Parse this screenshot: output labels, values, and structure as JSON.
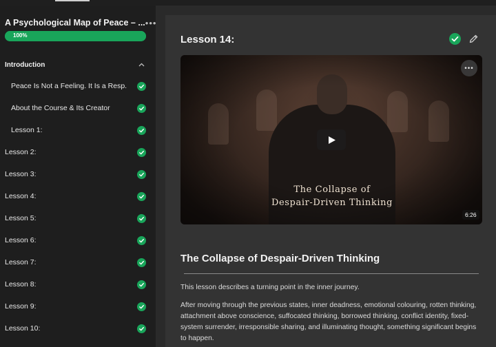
{
  "sidebar": {
    "course_title": "A Psychological Map of Peace – ...",
    "more_label": "•••",
    "progress": {
      "percent": 100,
      "label": "100%"
    },
    "section": {
      "label": "Introduction",
      "expanded": true
    },
    "items": [
      {
        "label": "Peace Is Not a Feeling. It Is a Resp...",
        "completed": true,
        "indent": true
      },
      {
        "label": "About the Course & Its Creator",
        "completed": true,
        "indent": true
      },
      {
        "label": "Lesson 1:",
        "completed": true,
        "indent": true
      },
      {
        "label": "Lesson 2:",
        "completed": true,
        "indent": false
      },
      {
        "label": "Lesson 3:",
        "completed": true,
        "indent": false
      },
      {
        "label": "Lesson 4:",
        "completed": true,
        "indent": false
      },
      {
        "label": "Lesson 5:",
        "completed": true,
        "indent": false
      },
      {
        "label": "Lesson 6:",
        "completed": true,
        "indent": false
      },
      {
        "label": "Lesson 7:",
        "completed": true,
        "indent": false
      },
      {
        "label": "Lesson 8:",
        "completed": true,
        "indent": false
      },
      {
        "label": "Lesson 9:",
        "completed": true,
        "indent": false
      },
      {
        "label": "Lesson 10:",
        "completed": true,
        "indent": false
      }
    ]
  },
  "main": {
    "lesson_heading": "Lesson 14:",
    "completed": true,
    "video": {
      "title_line1": "The Collapse of",
      "title_line2": "Despair-Driven Thinking",
      "duration": "6:26",
      "menu_label": "•••"
    },
    "content_title": "The Collapse of Despair-Driven Thinking",
    "paragraph1": "This lesson describes a turning point in the inner journey.",
    "paragraph2": "After moving through the previous states, inner deadness, emotional colouring, rotten thinking, attachment above conscience, suffocated thinking, borrowed thinking, conflict identity, fixed-system surrender, irresponsible sharing, and illuminating thought, something significant begins to happen."
  },
  "colors": {
    "accent_green": "#19a55a",
    "sidebar_bg": "#1e1e1e",
    "main_bg": "#333333"
  }
}
